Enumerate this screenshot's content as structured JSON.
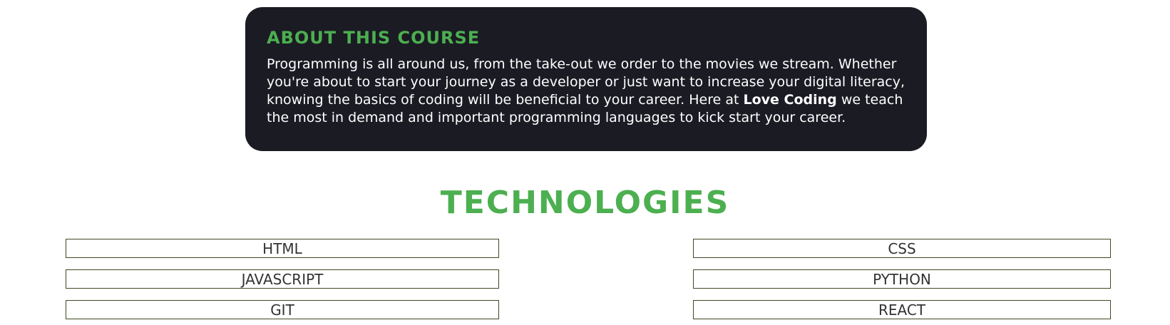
{
  "about": {
    "title": "ABOUT THIS COURSE",
    "text_before": "Programming is all around us, from the take-out we order to the movies we stream. Whether you're about to start your journey as a developer or just want to increase your digital literacy, knowing the basics of coding will be beneficial to your career. Here at ",
    "brand": "Love Coding",
    "text_after": " we teach the most in demand and important programming languages to kick start your career."
  },
  "technologies": {
    "heading": "TECHNOLOGIES",
    "items": [
      "HTML",
      "CSS",
      "JAVASCRIPT",
      "PYTHON",
      "GIT",
      "REACT"
    ]
  },
  "colors": {
    "accent": "#4caf50",
    "card_background": "#1b1b24",
    "item_border": "#3d4a23"
  }
}
